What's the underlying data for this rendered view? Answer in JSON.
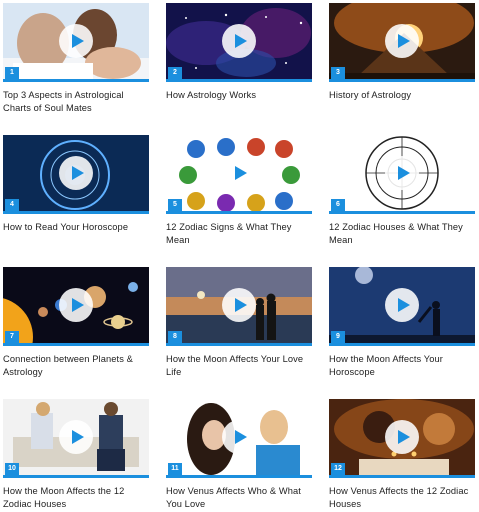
{
  "accent_color": "#1b8fde",
  "play_icon": "play-icon",
  "videos": [
    {
      "number": "1",
      "title": "Top 3 Aspects in Astrological Charts of Soul Mates"
    },
    {
      "number": "2",
      "title": "How Astrology Works"
    },
    {
      "number": "3",
      "title": "History of Astrology"
    },
    {
      "number": "4",
      "title": "How to Read Your Horoscope"
    },
    {
      "number": "5",
      "title": "12 Zodiac Signs & What They Mean"
    },
    {
      "number": "6",
      "title": "12 Zodiac Houses & What They Mean"
    },
    {
      "number": "7",
      "title": "Connection between Planets & Astrology"
    },
    {
      "number": "8",
      "title": "How the Moon Affects Your Love Life"
    },
    {
      "number": "9",
      "title": "How the Moon Affects Your Horoscope"
    },
    {
      "number": "10",
      "title": "How the Moon Affects the 12 Zodiac Houses"
    },
    {
      "number": "11",
      "title": "How Venus Affects Who & What You Love"
    },
    {
      "number": "12",
      "title": "How Venus Affects the 12 Zodiac Houses"
    }
  ]
}
